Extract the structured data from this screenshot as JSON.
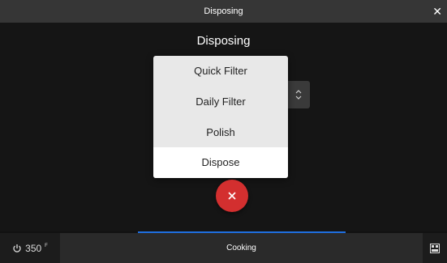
{
  "window": {
    "title": "Disposing",
    "close_icon": "close-icon"
  },
  "main": {
    "heading": "Disposing"
  },
  "dropdown": {
    "selected": "Dispose",
    "options": [
      "Quick Filter",
      "Daily Filter",
      "Polish",
      "Dispose"
    ]
  },
  "cancel_button": {
    "icon": "close-icon",
    "color": "#d32f2f"
  },
  "status_bar": {
    "temperature": "350",
    "unit": "F",
    "center_label": "Cooking",
    "right_icon": "keyboard-icon"
  },
  "colors": {
    "accent": "#1f6fe0",
    "danger": "#d32f2f"
  }
}
